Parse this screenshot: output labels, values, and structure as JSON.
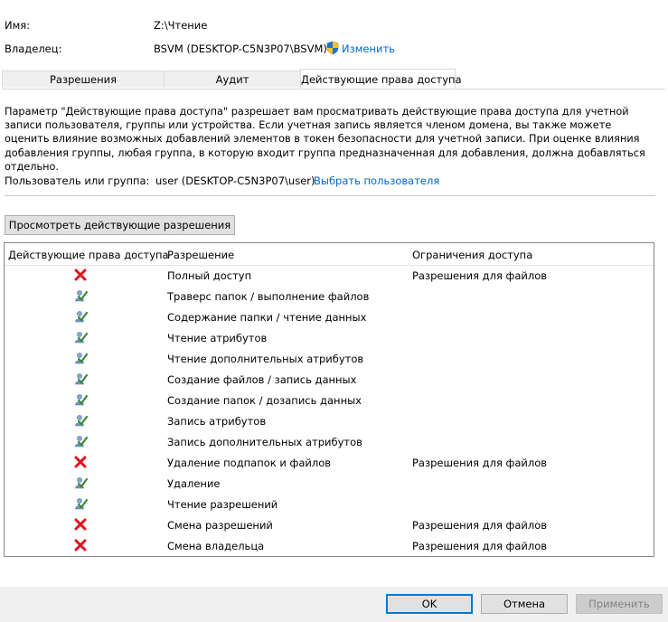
{
  "header": {
    "name_label": "Имя:",
    "name_value": "Z:\\Чтение",
    "owner_label": "Владелец:",
    "owner_value": "BSVM (DESKTOP-C5N3P07\\BSVM)",
    "change_link": "Изменить"
  },
  "tabs": [
    {
      "label": "Разрешения",
      "active": false
    },
    {
      "label": "Аудит",
      "active": false
    },
    {
      "label": "Действующие права доступа",
      "active": true
    }
  ],
  "description": "Параметр \"Действующие права доступа\" разрешает вам просматривать действующие права доступа для учетной записи пользователя, группы или устройства. Если учетная запись является членом домена, вы также можете оценить влияние возможных добавлений элементов в токен безопасности для учетной записи. При оценке влияния добавления группы, любая группа, в которую входит группа предназначенная для добавления, должна добавляться отдельно.",
  "principal": {
    "label": "Пользователь или группа:",
    "value": "user (DESKTOP-C5N3P07\\user)",
    "select_link": "Выбрать пользователя"
  },
  "view_button": "Просмотреть действующие разрешения",
  "table": {
    "columns": [
      "Действующие права доступа",
      "Разрешение",
      "Ограничения доступа"
    ],
    "rows": [
      {
        "status": "denied",
        "permission": "Полный доступ",
        "limit": "Разрешения для файлов"
      },
      {
        "status": "allowed",
        "permission": "Траверс папок / выполнение файлов",
        "limit": ""
      },
      {
        "status": "allowed",
        "permission": "Содержание папки / чтение данных",
        "limit": ""
      },
      {
        "status": "allowed",
        "permission": "Чтение атрибутов",
        "limit": ""
      },
      {
        "status": "allowed",
        "permission": "Чтение дополнительных атрибутов",
        "limit": ""
      },
      {
        "status": "allowed",
        "permission": "Создание файлов / запись данных",
        "limit": ""
      },
      {
        "status": "allowed",
        "permission": "Создание папок / дозапись данных",
        "limit": ""
      },
      {
        "status": "allowed",
        "permission": "Запись атрибутов",
        "limit": ""
      },
      {
        "status": "allowed",
        "permission": "Запись дополнительных атрибутов",
        "limit": ""
      },
      {
        "status": "denied",
        "permission": "Удаление подпапок и файлов",
        "limit": "Разрешения для файлов"
      },
      {
        "status": "allowed",
        "permission": "Удаление",
        "limit": ""
      },
      {
        "status": "allowed",
        "permission": "Чтение разрешений",
        "limit": ""
      },
      {
        "status": "denied",
        "permission": "Смена разрешений",
        "limit": "Разрешения для файлов"
      },
      {
        "status": "denied",
        "permission": "Смена владельца",
        "limit": "Разрешения для файлов"
      }
    ]
  },
  "footer": {
    "ok": "OK",
    "cancel": "Отмена",
    "apply": "Применить"
  },
  "colors": {
    "denied": "#e0141e",
    "allowed": "#3a8a3a",
    "link": "#0066cc",
    "ok_border": "#0078d7"
  },
  "icons": {
    "change": "uac-shield-icon",
    "denied": "red-cross-icon",
    "allowed": "user-check-icon"
  }
}
